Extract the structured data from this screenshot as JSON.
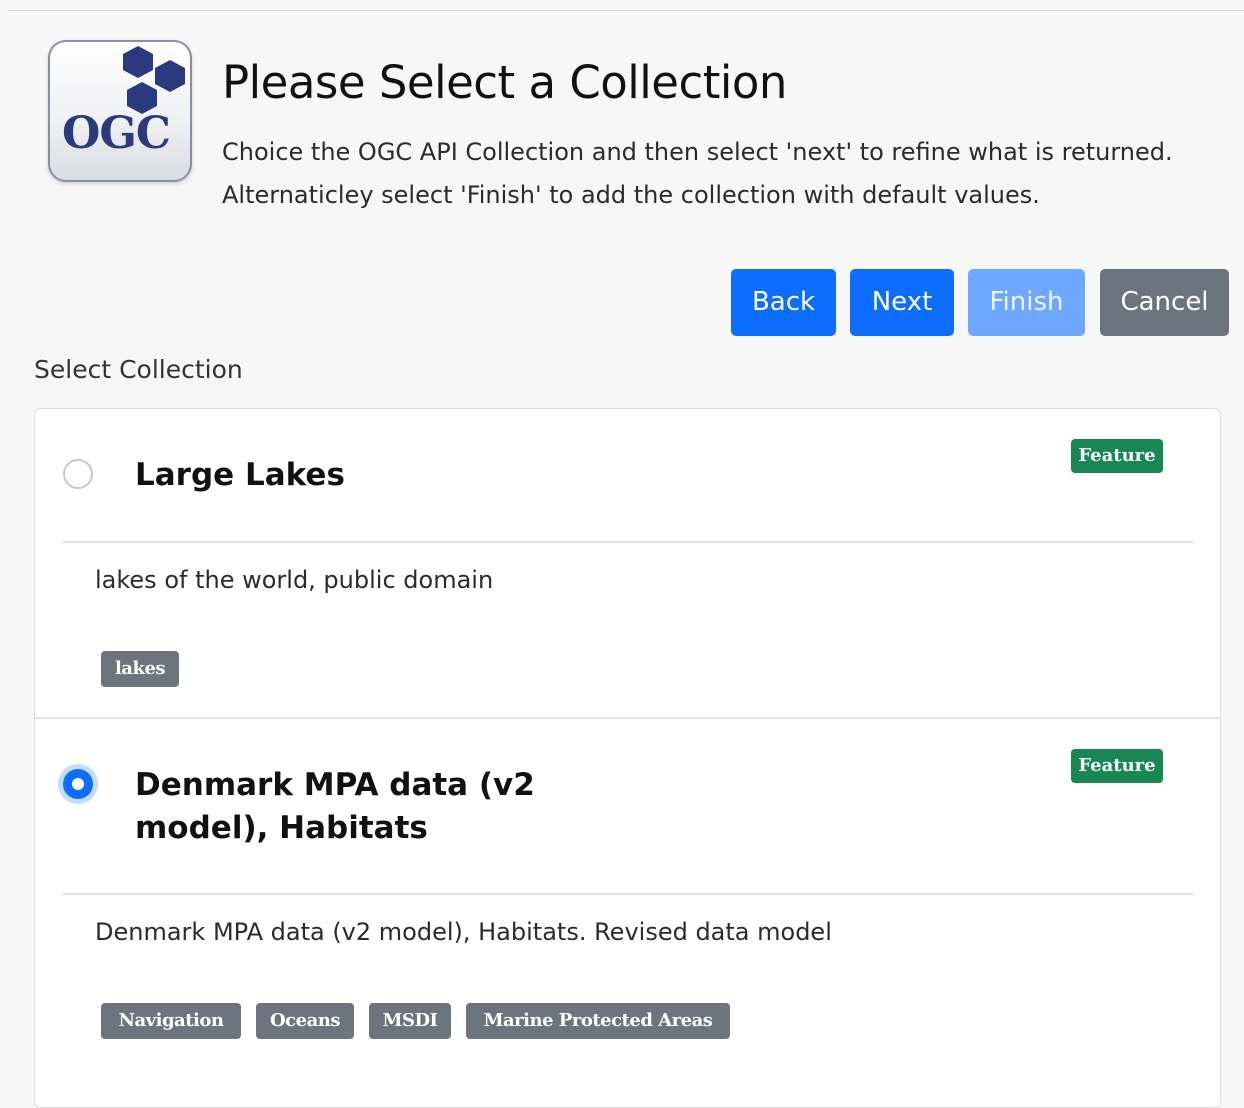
{
  "header": {
    "logo_text": "OGC",
    "title": "Please Select a Collection",
    "description_line1": "Choice the OGC API Collection and then select 'next' to refine what is returned.",
    "description_line2": "Alternaticley select 'Finish' to add the collection with default values."
  },
  "buttons": {
    "back": "Back",
    "next": "Next",
    "finish": "Finish",
    "cancel": "Cancel"
  },
  "section_label": "Select Collection",
  "collections": [
    {
      "title": "Large Lakes",
      "badge": "Feature",
      "description": "lakes of the world, public domain",
      "tags": [
        "lakes"
      ],
      "selected": false
    },
    {
      "title_line1": "Denmark MPA data (v2",
      "title_line2": "model), Habitats",
      "badge": "Feature",
      "description": "Denmark MPA data (v2 model), Habitats. Revised data model",
      "tags": [
        "Navigation",
        "Oceans",
        "MSDI",
        "Marine Protected Areas"
      ],
      "selected": true
    }
  ],
  "colors": {
    "primary": "#0d6efd",
    "primary_disabled": "#6ea8fe",
    "secondary": "#6c757d",
    "success": "#198754",
    "logo_blue": "#2b3a7e"
  }
}
